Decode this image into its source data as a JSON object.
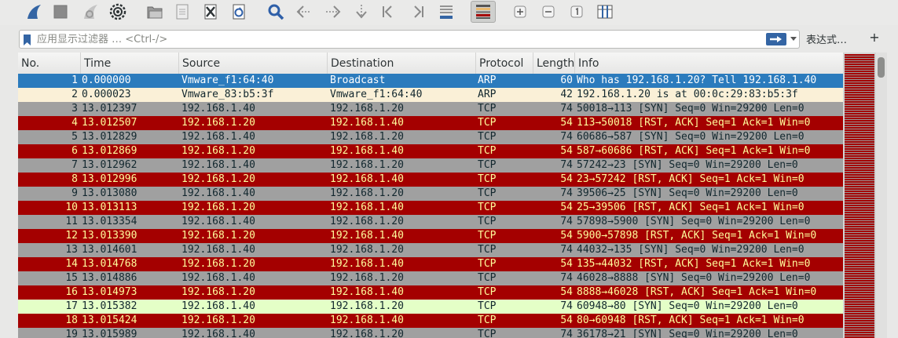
{
  "toolbar": {
    "buttons": [
      {
        "name": "shark-fin-start-icon"
      },
      {
        "name": "stop-square-icon"
      },
      {
        "name": "restart-shark-fin-icon"
      },
      {
        "name": "capture-options-gear-icon"
      },
      {
        "name": "open-folder-icon"
      },
      {
        "name": "save-file-icon"
      },
      {
        "name": "close-file-icon"
      },
      {
        "name": "reload-icon"
      },
      {
        "name": "search-icon"
      },
      {
        "name": "go-back-icon"
      },
      {
        "name": "go-forward-icon"
      },
      {
        "name": "go-to-packet-icon"
      },
      {
        "name": "first-packet-icon"
      },
      {
        "name": "last-packet-icon"
      },
      {
        "name": "autoscroll-icon"
      },
      {
        "name": "colorize-icon"
      },
      {
        "name": "zoom-in-icon"
      },
      {
        "name": "zoom-out-icon"
      },
      {
        "name": "zoom-normal-icon"
      },
      {
        "name": "resize-columns-icon"
      }
    ]
  },
  "filter": {
    "placeholder": "应用显示过滤器 … <Ctrl-/>",
    "value": "",
    "expression_label": "表达式…",
    "add_label": "+"
  },
  "columns": [
    "No.",
    "Time",
    "Source",
    "Destination",
    "Protocol",
    "Length",
    "Info"
  ],
  "colors": {
    "selected": "#2b7bbd",
    "arp": "#faf0d7",
    "tcp_syn": "#a0a0a0",
    "tcp_rst": "#a40000",
    "http": "#e4ffc7"
  },
  "packets": [
    {
      "no": "1",
      "time": "0.000000",
      "source": "Vmware_f1:64:40",
      "destination": "Broadcast",
      "protocol": "ARP",
      "length": "60",
      "info": "Who has 192.168.1.20? Tell 192.168.1.40",
      "style": "selected"
    },
    {
      "no": "2",
      "time": "0.000023",
      "source": "Vmware_83:b5:3f",
      "destination": "Vmware_f1:64:40",
      "protocol": "ARP",
      "length": "42",
      "info": "192.168.1.20 is at 00:0c:29:83:b5:3f",
      "style": "arp"
    },
    {
      "no": "3",
      "time": "13.012397",
      "source": "192.168.1.40",
      "destination": "192.168.1.20",
      "protocol": "TCP",
      "length": "74",
      "info": "50018→113 [SYN] Seq=0 Win=29200 Len=0",
      "style": "syn"
    },
    {
      "no": "4",
      "time": "13.012507",
      "source": "192.168.1.20",
      "destination": "192.168.1.40",
      "protocol": "TCP",
      "length": "54",
      "info": "113→50018 [RST, ACK] Seq=1 Ack=1 Win=0",
      "style": "rst"
    },
    {
      "no": "5",
      "time": "13.012829",
      "source": "192.168.1.40",
      "destination": "192.168.1.20",
      "protocol": "TCP",
      "length": "74",
      "info": "60686→587 [SYN] Seq=0 Win=29200 Len=0",
      "style": "syn"
    },
    {
      "no": "6",
      "time": "13.012869",
      "source": "192.168.1.20",
      "destination": "192.168.1.40",
      "protocol": "TCP",
      "length": "54",
      "info": "587→60686 [RST, ACK] Seq=1 Ack=1 Win=0",
      "style": "rst"
    },
    {
      "no": "7",
      "time": "13.012962",
      "source": "192.168.1.40",
      "destination": "192.168.1.20",
      "protocol": "TCP",
      "length": "74",
      "info": "57242→23 [SYN] Seq=0 Win=29200 Len=0",
      "style": "syn"
    },
    {
      "no": "8",
      "time": "13.012996",
      "source": "192.168.1.20",
      "destination": "192.168.1.40",
      "protocol": "TCP",
      "length": "54",
      "info": "23→57242 [RST, ACK] Seq=1 Ack=1 Win=0",
      "style": "rst"
    },
    {
      "no": "9",
      "time": "13.013080",
      "source": "192.168.1.40",
      "destination": "192.168.1.20",
      "protocol": "TCP",
      "length": "74",
      "info": "39506→25 [SYN] Seq=0 Win=29200 Len=0",
      "style": "syn"
    },
    {
      "no": "10",
      "time": "13.013113",
      "source": "192.168.1.20",
      "destination": "192.168.1.40",
      "protocol": "TCP",
      "length": "54",
      "info": "25→39506 [RST, ACK] Seq=1 Ack=1 Win=0",
      "style": "rst"
    },
    {
      "no": "11",
      "time": "13.013354",
      "source": "192.168.1.40",
      "destination": "192.168.1.20",
      "protocol": "TCP",
      "length": "74",
      "info": "57898→5900 [SYN] Seq=0 Win=29200 Len=0",
      "style": "syn"
    },
    {
      "no": "12",
      "time": "13.013390",
      "source": "192.168.1.20",
      "destination": "192.168.1.40",
      "protocol": "TCP",
      "length": "54",
      "info": "5900→57898 [RST, ACK] Seq=1 Ack=1 Win=0",
      "style": "rst"
    },
    {
      "no": "13",
      "time": "13.014601",
      "source": "192.168.1.40",
      "destination": "192.168.1.20",
      "protocol": "TCP",
      "length": "74",
      "info": "44032→135 [SYN] Seq=0 Win=29200 Len=0",
      "style": "syn"
    },
    {
      "no": "14",
      "time": "13.014768",
      "source": "192.168.1.20",
      "destination": "192.168.1.40",
      "protocol": "TCP",
      "length": "54",
      "info": "135→44032 [RST, ACK] Seq=1 Ack=1 Win=0",
      "style": "rst"
    },
    {
      "no": "15",
      "time": "13.014886",
      "source": "192.168.1.40",
      "destination": "192.168.1.20",
      "protocol": "TCP",
      "length": "74",
      "info": "46028→8888 [SYN] Seq=0 Win=29200 Len=0",
      "style": "syn"
    },
    {
      "no": "16",
      "time": "13.014973",
      "source": "192.168.1.20",
      "destination": "192.168.1.40",
      "protocol": "TCP",
      "length": "54",
      "info": "8888→46028 [RST, ACK] Seq=1 Ack=1 Win=0",
      "style": "rst"
    },
    {
      "no": "17",
      "time": "13.015382",
      "source": "192.168.1.40",
      "destination": "192.168.1.20",
      "protocol": "TCP",
      "length": "74",
      "info": "60948→80 [SYN] Seq=0 Win=29200 Len=0",
      "style": "http"
    },
    {
      "no": "18",
      "time": "13.015424",
      "source": "192.168.1.20",
      "destination": "192.168.1.40",
      "protocol": "TCP",
      "length": "54",
      "info": "80→60948 [RST, ACK] Seq=1 Ack=1 Win=0",
      "style": "rst"
    },
    {
      "no": "19",
      "time": "13.015989",
      "source": "192.168.1.40",
      "destination": "192.168.1.20",
      "protocol": "TCP",
      "length": "74",
      "info": "36178→21 [SYN] Seq=0 Win=29200 Len=0",
      "style": "syn"
    }
  ]
}
